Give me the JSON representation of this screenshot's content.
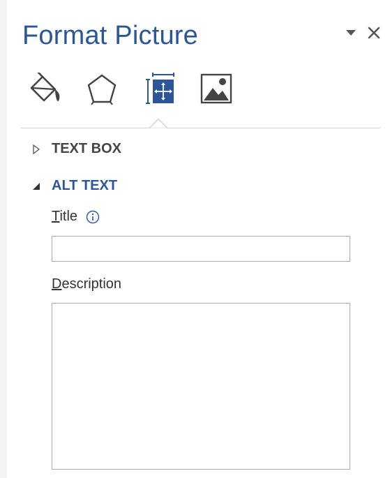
{
  "pane": {
    "title": "Format Picture",
    "controls": {
      "options_icon": "dropdown-triangle-icon",
      "close_icon": "close-icon"
    },
    "tabs": [
      {
        "name": "Fill & Line",
        "icon": "paint-bucket-icon",
        "selected": false
      },
      {
        "name": "Effects",
        "icon": "pentagon-icon",
        "selected": false
      },
      {
        "name": "Size & Properties",
        "icon": "size-properties-icon",
        "selected": true
      },
      {
        "name": "Picture",
        "icon": "picture-icon",
        "selected": false
      }
    ]
  },
  "sections": {
    "text_box": {
      "label": "TEXT BOX",
      "expanded": false
    },
    "alt_text": {
      "label": "ALT TEXT",
      "expanded": true,
      "title_label_key": "T",
      "title_label_rest": "itle",
      "title_value": "",
      "info_icon": "info-icon",
      "description_label_key": "D",
      "description_label_rest": "escription",
      "description_value": ""
    }
  },
  "colors": {
    "accent": "#2b579a",
    "icon": "#444444",
    "text": "#333333",
    "border": "#ababab"
  }
}
